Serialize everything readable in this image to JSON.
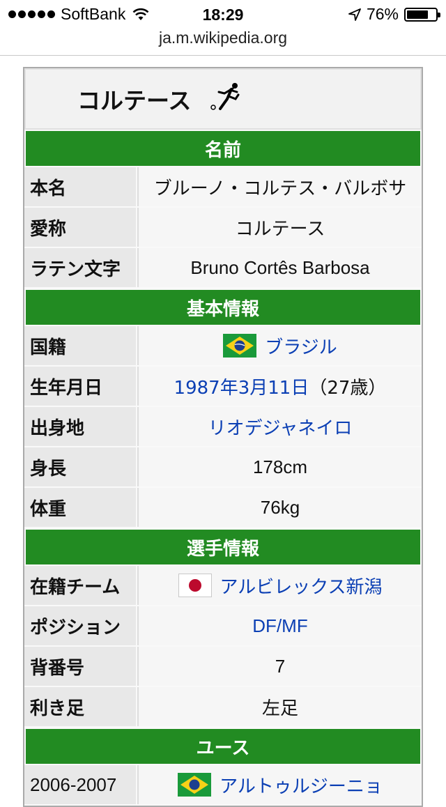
{
  "statusbar": {
    "carrier": "SoftBank",
    "time": "18:29",
    "battery": "76%",
    "battery_level": 0.76
  },
  "url": "ja.m.wikipedia.org",
  "infobox": {
    "title": "コルテース",
    "sections": {
      "name": "名前",
      "basic": "基本情報",
      "player": "選手情報",
      "youth": "ユース"
    },
    "rows": {
      "honmyo": {
        "key": "本名",
        "value": "ブルーノ・コルテス・バルボサ"
      },
      "aisho": {
        "key": "愛称",
        "value": "コルテース"
      },
      "latin": {
        "key": "ラテン文字",
        "value": "Bruno Cortês Barbosa"
      },
      "country": {
        "key": "国籍",
        "value": "ブラジル"
      },
      "born": {
        "key": "生年月日",
        "date": "1987年3月11日",
        "age": "（27歳）"
      },
      "birthplace": {
        "key": "出身地",
        "value": "リオデジャネイロ"
      },
      "height": {
        "key": "身長",
        "value": "178cm"
      },
      "weight": {
        "key": "体重",
        "value": "76kg"
      },
      "team": {
        "key": "在籍チーム",
        "value": "アルビレックス新潟"
      },
      "position": {
        "key": "ポジション",
        "value": "DF/MF"
      },
      "number": {
        "key": "背番号",
        "value": "7"
      },
      "foot": {
        "key": "利き足",
        "value": "左足"
      },
      "youth1": {
        "key": "2006-2007",
        "value": "アルトゥルジーニョ"
      }
    }
  },
  "icons": {
    "flag_brazil": "brazil-flag-icon",
    "flag_japan": "japan-flag-icon",
    "football": "football-player-icon"
  },
  "colors": {
    "section_green": "#228b22",
    "link_blue": "#0b3fb4"
  }
}
